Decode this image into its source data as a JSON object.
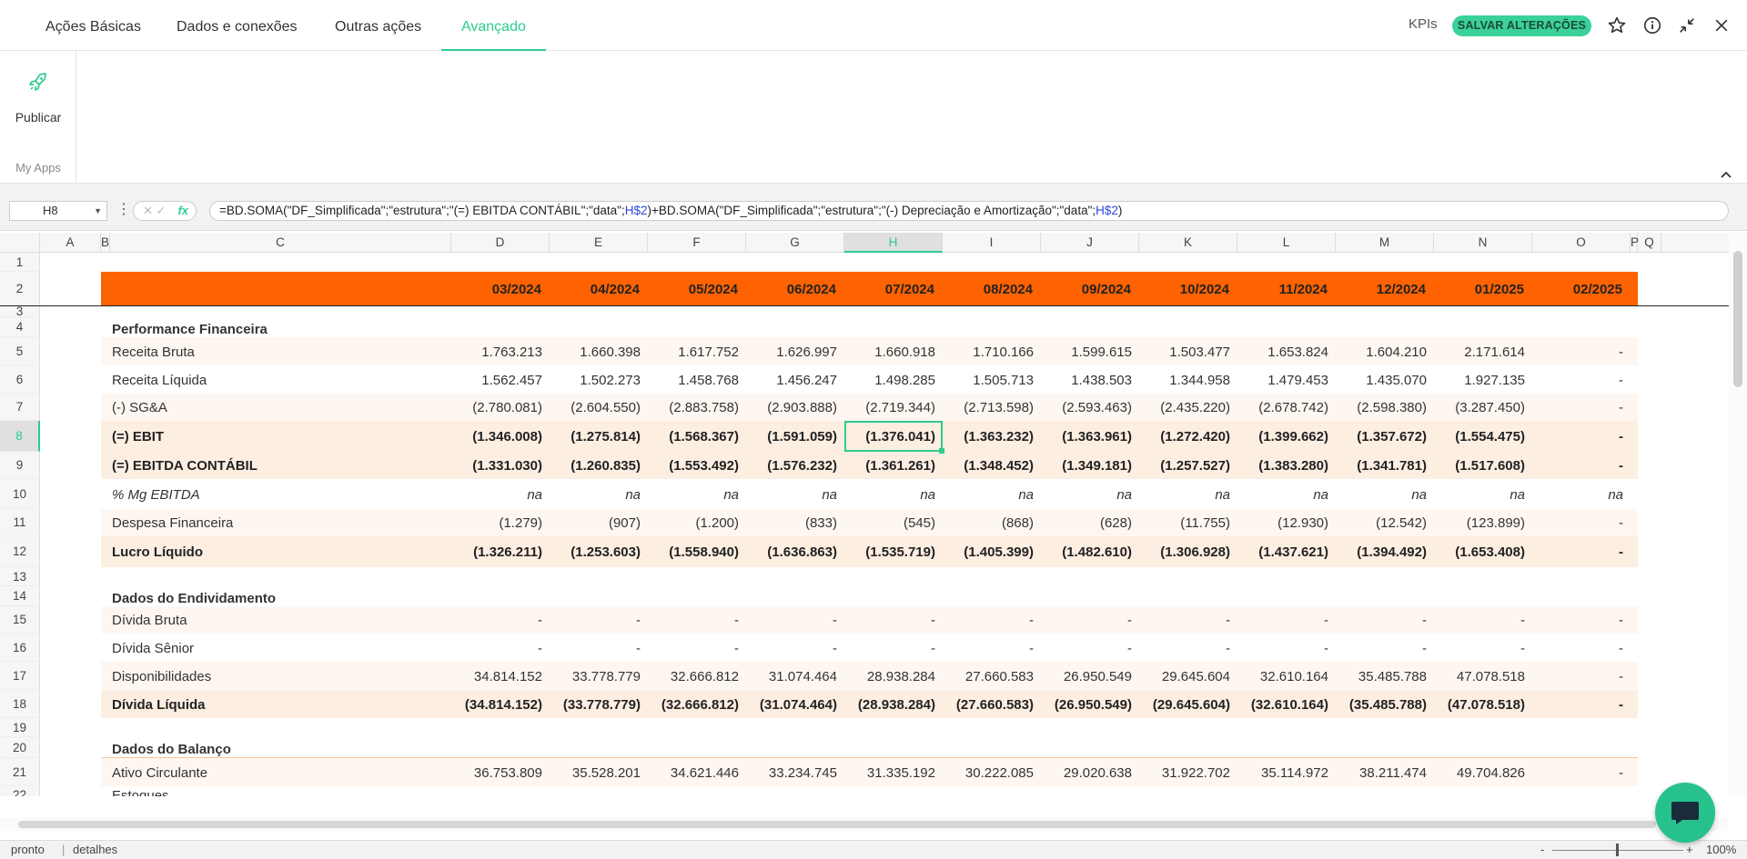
{
  "tabs": [
    "Ações Básicas",
    "Dados e conexões",
    "Outras ações",
    "Avançado"
  ],
  "active_tab": "Avançado",
  "kpis_label": "KPIs",
  "save_label": "SALVAR ALTERAÇÕES",
  "ribbon": {
    "publish_label": "Publicar",
    "group_label": "My Apps"
  },
  "namebox": "H8",
  "formula": {
    "part1": "=BD.SOMA(\"DF_Simplificada\";\"estrutura\";\"(=) EBITDA CONTÁBIL\";\"data\";",
    "ref1": "H$2",
    "part2": ")+BD.SOMA(\"DF_Simplificada\";\"estrutura\";\"(-) Depreciação e Amortização\";\"data\";",
    "ref2": "H$2",
    "part3": ")"
  },
  "columns": [
    "A",
    "B",
    "C",
    "D",
    "E",
    "F",
    "G",
    "H",
    "I",
    "J",
    "K",
    "L",
    "M",
    "N",
    "O",
    "P",
    "Q"
  ],
  "selected_column": "H",
  "row_numbers": [
    "1",
    "2",
    "3",
    "4",
    "5",
    "6",
    "7",
    "8",
    "9",
    "10",
    "11",
    "12",
    "13",
    "14",
    "15",
    "16",
    "17",
    "18",
    "19",
    "20",
    "21",
    "22"
  ],
  "selected_row": "8",
  "dates": [
    "03/2024",
    "04/2024",
    "05/2024",
    "06/2024",
    "07/2024",
    "08/2024",
    "09/2024",
    "10/2024",
    "11/2024",
    "12/2024",
    "01/2025",
    "02/2025"
  ],
  "sections": {
    "performance": "Performance Financeira",
    "endividamento": "Dados do Endividamento",
    "balanco": "Dados do Balanço"
  },
  "rows": [
    {
      "row": "5",
      "label": "Receita Bruta",
      "values": [
        "1.763.213",
        "1.660.398",
        "1.617.752",
        "1.626.997",
        "1.660.918",
        "1.710.166",
        "1.599.615",
        "1.503.477",
        "1.653.824",
        "1.604.210",
        "2.171.614",
        "-"
      ]
    },
    {
      "row": "6",
      "label": "Receita Líquida",
      "values": [
        "1.562.457",
        "1.502.273",
        "1.458.768",
        "1.456.247",
        "1.498.285",
        "1.505.713",
        "1.438.503",
        "1.344.958",
        "1.479.453",
        "1.435.070",
        "1.927.135",
        "-"
      ]
    },
    {
      "row": "7",
      "label": "(-) SG&A",
      "values": [
        "(2.780.081)",
        "(2.604.550)",
        "(2.883.758)",
        "(2.903.888)",
        "(2.719.344)",
        "(2.713.598)",
        "(2.593.463)",
        "(2.435.220)",
        "(2.678.742)",
        "(2.598.380)",
        "(3.287.450)",
        "-"
      ]
    },
    {
      "row": "8",
      "label": "(=) EBIT",
      "values": [
        "(1.346.008)",
        "(1.275.814)",
        "(1.568.367)",
        "(1.591.059)",
        "(1.376.041)",
        "(1.363.232)",
        "(1.363.961)",
        "(1.272.420)",
        "(1.399.662)",
        "(1.357.672)",
        "(1.554.475)",
        "-"
      ]
    },
    {
      "row": "9",
      "label": "(=) EBITDA CONTÁBIL",
      "values": [
        "(1.331.030)",
        "(1.260.835)",
        "(1.553.492)",
        "(1.576.232)",
        "(1.361.261)",
        "(1.348.452)",
        "(1.349.181)",
        "(1.257.527)",
        "(1.383.280)",
        "(1.341.781)",
        "(1.517.608)",
        "-"
      ]
    },
    {
      "row": "10",
      "label": "% Mg EBITDA",
      "values": [
        "na",
        "na",
        "na",
        "na",
        "na",
        "na",
        "na",
        "na",
        "na",
        "na",
        "na",
        "na"
      ]
    },
    {
      "row": "11",
      "label": "Despesa Financeira",
      "values": [
        "(1.279)",
        "(907)",
        "(1.200)",
        "(833)",
        "(545)",
        "(868)",
        "(628)",
        "(11.755)",
        "(12.930)",
        "(12.542)",
        "(123.899)",
        "-"
      ]
    },
    {
      "row": "12",
      "label": "Lucro Líquido",
      "values": [
        "(1.326.211)",
        "(1.253.603)",
        "(1.558.940)",
        "(1.636.863)",
        "(1.535.719)",
        "(1.405.399)",
        "(1.482.610)",
        "(1.306.928)",
        "(1.437.621)",
        "(1.394.492)",
        "(1.653.408)",
        "-"
      ]
    },
    {
      "row": "15",
      "label": "Dívida Bruta",
      "values": [
        "-",
        "-",
        "-",
        "-",
        "-",
        "-",
        "-",
        "-",
        "-",
        "-",
        "-",
        "-"
      ]
    },
    {
      "row": "16",
      "label": "Dívida Sênior",
      "values": [
        "-",
        "-",
        "-",
        "-",
        "-",
        "-",
        "-",
        "-",
        "-",
        "-",
        "-",
        "-"
      ]
    },
    {
      "row": "17",
      "label": "Disponibilidades",
      "values": [
        "34.814.152",
        "33.778.779",
        "32.666.812",
        "31.074.464",
        "28.938.284",
        "27.660.583",
        "26.950.549",
        "29.645.604",
        "32.610.164",
        "35.485.788",
        "47.078.518",
        "-"
      ]
    },
    {
      "row": "18",
      "label": "Dívida Líquida",
      "values": [
        "(34.814.152)",
        "(33.778.779)",
        "(32.666.812)",
        "(31.074.464)",
        "(28.938.284)",
        "(27.660.583)",
        "(26.950.549)",
        "(29.645.604)",
        "(32.610.164)",
        "(35.485.788)",
        "(47.078.518)",
        "-"
      ]
    },
    {
      "row": "21",
      "label": "Ativo Circulante",
      "values": [
        "36.753.809",
        "35.528.201",
        "34.621.446",
        "33.234.745",
        "31.335.192",
        "30.222.085",
        "29.020.638",
        "31.922.702",
        "35.114.972",
        "38.211.474",
        "49.704.826",
        "-"
      ]
    },
    {
      "row": "22",
      "label": "Estoques",
      "values": []
    }
  ],
  "status": {
    "left": "pronto",
    "details": "detalhes",
    "zoom": "100%"
  },
  "colors": {
    "accent": "#2ecc8f",
    "header_band": "#ff6200",
    "bold_row_bg": "#fdeee2",
    "light_row_bg": "#fef7f1"
  }
}
